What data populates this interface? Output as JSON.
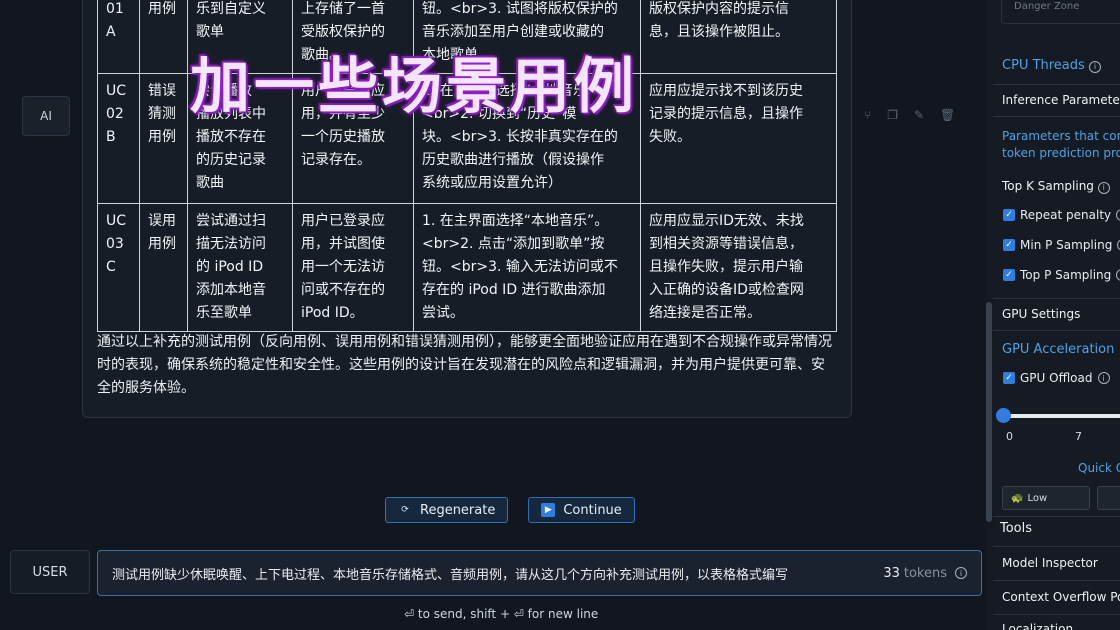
{
  "overlay_caption": "加一些场景用例",
  "assistant_badge": "AI",
  "user_badge": "USER",
  "table": {
    "rows": [
      {
        "id": "01\nA",
        "type": "用例",
        "desc": "乐到自定义\n歌单",
        "pre": "上存储了一首\n受版权保护的\n歌曲。",
        "steps": "钮。<br>3. 试图将版权保护的\n音乐添加至用户创建或收藏的\n本地歌单",
        "expect": "版权保护内容的提示信\n息，且该操作被阻止。"
      },
      {
        "id": "UC\n02\nB",
        "type": "错误\n猜测\n用例",
        "desc": "尝试播放\n播放列表中\n播放不存在\n的历史记录\n歌曲",
        "pre": "用户已登录应\n用，并有至少\n一个历史播放\n记录存在。",
        "steps": "1. 在主界面选择“本地音乐”\n<br>2. 切换到“历史”模\n块。<br>3. 长按非真实存在的\n历史歌曲进行播放（假设操作\n系统或应用设置允许）",
        "expect": "应用应提示找不到该历史\n记录的提示信息，且操作\n失败。"
      },
      {
        "id": "UC\n03\nC",
        "type": "误用\n用例",
        "desc": "尝试通过扫\n描无法访问\n的 iPod ID\n添加本地音\n乐至歌单",
        "pre": "用户已登录应\n用，并试图使\n用一个无法访\n问或不存在的\niPod ID。",
        "steps": "1. 在主界面选择“本地音乐”。\n<br>2. 点击“添加到歌单”按\n钮。<br>3. 输入无法访问或不\n存在的 iPod ID 进行歌曲添加\n尝试。",
        "expect": "应用应显示ID无效、未找\n到相关资源等错误信息，\n且操作失败，提示用户输\n入正确的设备ID或检查网\n络连接是否正常。"
      }
    ]
  },
  "summary": "通过以上补充的测试用例（反向用例、误用用例和错误猜测用例），能够更全面地验证应用在遇到不合规操作或异常情况时的表现，确保系统的稳定性和安全性。这些用例的设计旨在发现潜在的风险点和逻辑漏洞，并为用户提供更可靠、安全的服务体验。",
  "buttons": {
    "regenerate": "Regenerate",
    "continue": "Continue"
  },
  "input": {
    "value": "测试用例缺少休眠唤醒、上下电过程、本地音乐存储格式、音频用例，请从这几个方向补充测试用例，以表格格式编写",
    "token_count": "33",
    "token_label": "tokens"
  },
  "hint": "⏎ to send, shift + ⏎ for new line",
  "panel": {
    "danger_zone": "Danger Zone",
    "cpu_threads": "CPU Threads",
    "inference_parameters": "Inference Parameters",
    "inference_desc_1": "Parameters that cont",
    "inference_desc_2": "token prediction pro",
    "top_k": "Top K Sampling",
    "repeat_penalty": "Repeat penalty",
    "min_p": "Min P Sampling",
    "top_p": "Top P Sampling",
    "gpu_settings": "GPU Settings",
    "gpu_acceleration": "GPU Acceleration",
    "gpu_offload": "GPU Offload",
    "slider_min": "0",
    "slider_mark": "7",
    "quick_gpu": "Quick GP",
    "low": "Low",
    "tools": "Tools",
    "model_inspector": "Model Inspector",
    "context_overflow": "Context Overflow Polic",
    "localization": "Localization"
  },
  "colors": {
    "accent": "#2f7de0",
    "link": "#4aa3e8",
    "background": "#12171f"
  }
}
